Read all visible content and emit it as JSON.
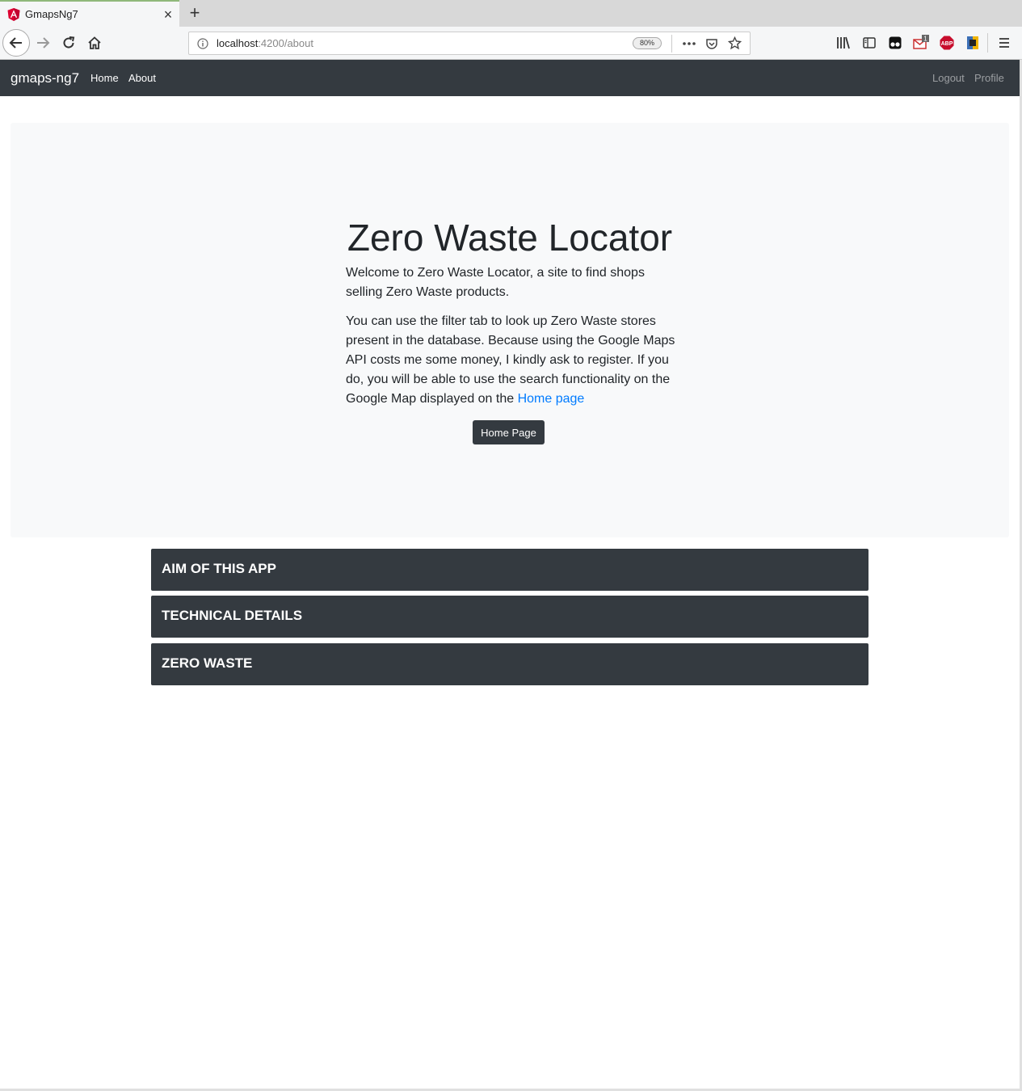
{
  "browser": {
    "tab_title": "GmapsNg7",
    "url_host": "localhost",
    "url_path": ":4200/about",
    "zoom": "80%",
    "notification_count": "1",
    "abp_label": "ABP"
  },
  "app": {
    "brand": "gmaps-ng7",
    "nav": {
      "home": "Home",
      "about": "About",
      "logout": "Logout",
      "profile": "Profile"
    },
    "hero": {
      "title": "Zero Waste Locator",
      "para1": "Welcome to Zero Waste Locator, a site to find shops selling Zero Waste products.",
      "para2": "You can use the filter tab to look up Zero Waste stores present in the database. Because using the Google Maps API costs me some money, I kindly ask to register. If you do, you will be able to use the search functionality on the Google Map displayed on the",
      "para2_link": "Home page",
      "button": "Home Page"
    },
    "accordion": [
      "AIM OF THIS APP",
      "TECHNICAL DETAILS",
      "ZERO WASTE"
    ]
  },
  "colors": {
    "navbar": "#343a40",
    "jumbotron": "#f8f9fa",
    "link": "#007bff"
  }
}
